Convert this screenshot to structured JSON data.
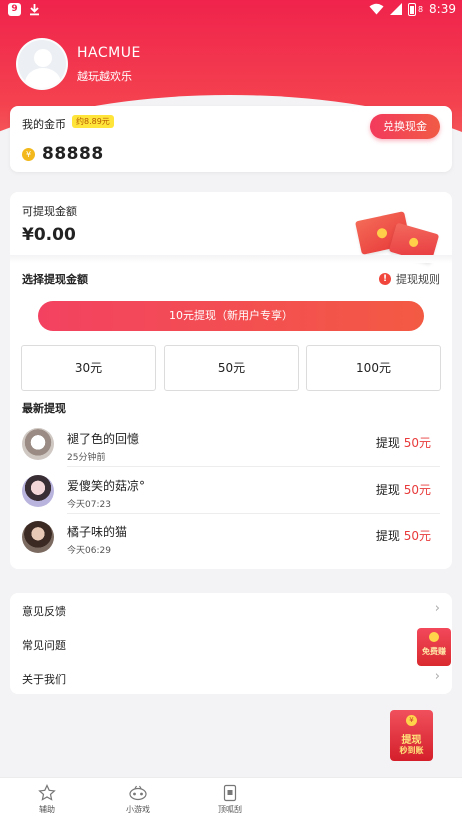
{
  "status_bar": {
    "time": "8:39",
    "battery": "8",
    "app_glyph": "9"
  },
  "profile": {
    "name": "HACMUE",
    "slogan": "越玩越欢乐"
  },
  "coins": {
    "label": "我的金币",
    "approx_badge": "约8.89元",
    "value": "88888",
    "coin_symbol": "¥",
    "exchange_label": "兑换现金"
  },
  "withdraw": {
    "available_label": "可提现金额",
    "available_value": "¥0.00",
    "choose_label": "选择提现金额",
    "rules_label": "提现规则",
    "primary_option": "10元提现（新用户专享）",
    "options": [
      "30元",
      "50元",
      "100元"
    ],
    "latest_label": "最新提现",
    "records": [
      {
        "name": "褪了色的回憶",
        "time": "25分钟前",
        "prefix": "提现",
        "amount": "50元"
      },
      {
        "name": "爱傻笑的菇凉°",
        "time": "今天07:23",
        "prefix": "提现",
        "amount": "50元"
      },
      {
        "name": "橘子味的猫",
        "time": "今天06:29",
        "prefix": "提现",
        "amount": "50元"
      }
    ]
  },
  "menu": {
    "items": [
      {
        "label": "意见反馈",
        "chevron": "›"
      },
      {
        "label": "常见问题",
        "chevron": "›"
      },
      {
        "label": "关于我们",
        "chevron": "›"
      }
    ]
  },
  "floating": {
    "badge_text": "免费赚",
    "withdraw_line1": "提现",
    "withdraw_line2": "秒到账",
    "coin_symbol": "¥"
  },
  "bottom_nav": {
    "items": [
      {
        "label": "辅助",
        "icon": "star-icon"
      },
      {
        "label": "小游戏",
        "icon": "gamepad-icon"
      },
      {
        "label": "顶呱刮",
        "icon": "scratch-card-icon"
      }
    ]
  },
  "colors": {
    "brand_red": "#f0234c",
    "amount_red": "#e83b3b",
    "badge_yellow": "#ffe43a",
    "coin_gold": "#f2b81c"
  }
}
